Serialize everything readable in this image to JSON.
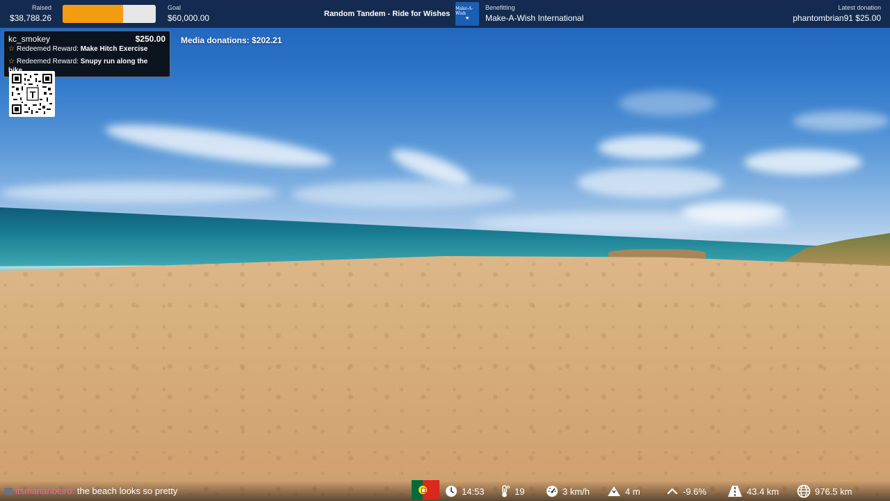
{
  "topbar": {
    "raised_label": "Raised",
    "raised_value": "$38,788.26",
    "raised_progress": 0.6465,
    "goal_label": "Goal",
    "goal_value": "$60,000.00",
    "event_title": "Random Tandem - Ride for Wishes",
    "logo_text": "Make-A-Wish",
    "benefitting_label": "Benefitting",
    "benefitting_value": "Make-A-Wish International",
    "latest_label": "Latest donation",
    "latest_value": "phantombrian91 $25.00"
  },
  "alert": {
    "user": "kc_smokey",
    "amount": "$250.00",
    "rewards": [
      {
        "prefix": "Redeemed Reward: ",
        "name": "Make Hitch Exercise"
      },
      {
        "prefix": "Redeemed Reward: ",
        "name": "Snupy run along the bike"
      }
    ],
    "qr_letter": "T"
  },
  "media_donations": "Media donations: $202.21",
  "chat": {
    "user": "itsmariaribeiro",
    "separator": ": ",
    "message": "the beach looks so pretty"
  },
  "stats": {
    "time": "14:53",
    "temperature": "19",
    "speed": "3 km/h",
    "elevation": "4 m",
    "grade": "-9.6%",
    "distance_today": "43.4 km",
    "distance_total": "976.5 km"
  },
  "icons": {
    "flag": "portugal-flag-icon",
    "clock": "clock-icon",
    "thermometer": "thermometer-icon",
    "speed": "speedometer-icon",
    "elevation": "mountain-icon",
    "grade": "chevron-up-icon",
    "distance": "road-icon",
    "total": "globe-icon"
  },
  "colors": {
    "progress": "#f39c12",
    "topbar": "#142646",
    "chat_user": "#e56b9a"
  }
}
